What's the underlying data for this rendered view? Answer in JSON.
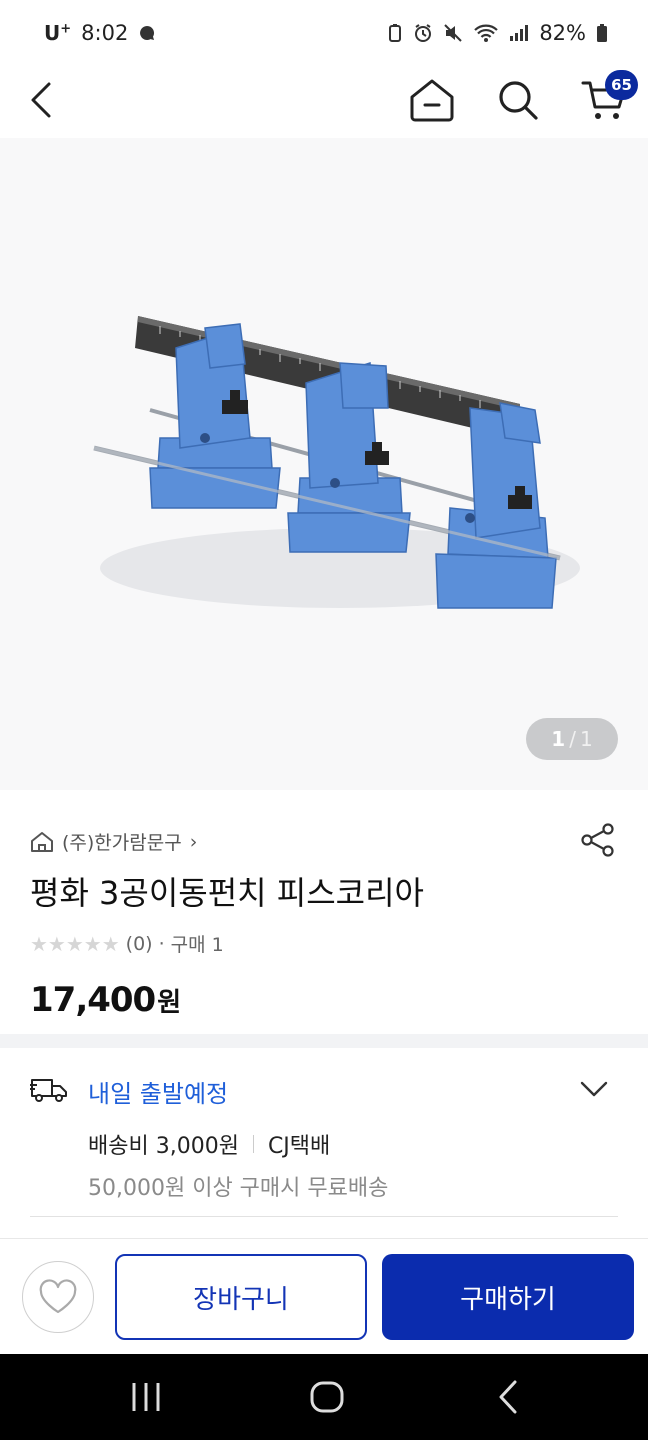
{
  "status_bar": {
    "carrier": "U",
    "carrier_plus": "+",
    "time": "8:02",
    "battery_percent": "82%"
  },
  "nav": {
    "cart_count": "65"
  },
  "gallery": {
    "current": "1",
    "separator": "/",
    "total": "1"
  },
  "product": {
    "shop_name": "(주)한가람문구",
    "shop_chevron": "›",
    "title": "평화 3공이동펀치 피스코리아",
    "stars": "★★★★★",
    "rating_count": "(0)",
    "dot": "·",
    "purchase_label": "구매 1",
    "price": "17,400",
    "price_unit": "원",
    "rating_value": 0
  },
  "delivery": {
    "title": "내일 출발예정",
    "fee": "배송비 3,000원",
    "carrier": "CJ택배",
    "free_condition": "50,000원 이상 구매시 무료배송"
  },
  "actions": {
    "cart_label": "장바구니",
    "buy_label": "구매하기"
  },
  "colors": {
    "primary": "#0b2cae",
    "delivery_accent": "#1f5fd9",
    "badge": "#0b2a9e",
    "product_blue": "#5b8fd9"
  }
}
